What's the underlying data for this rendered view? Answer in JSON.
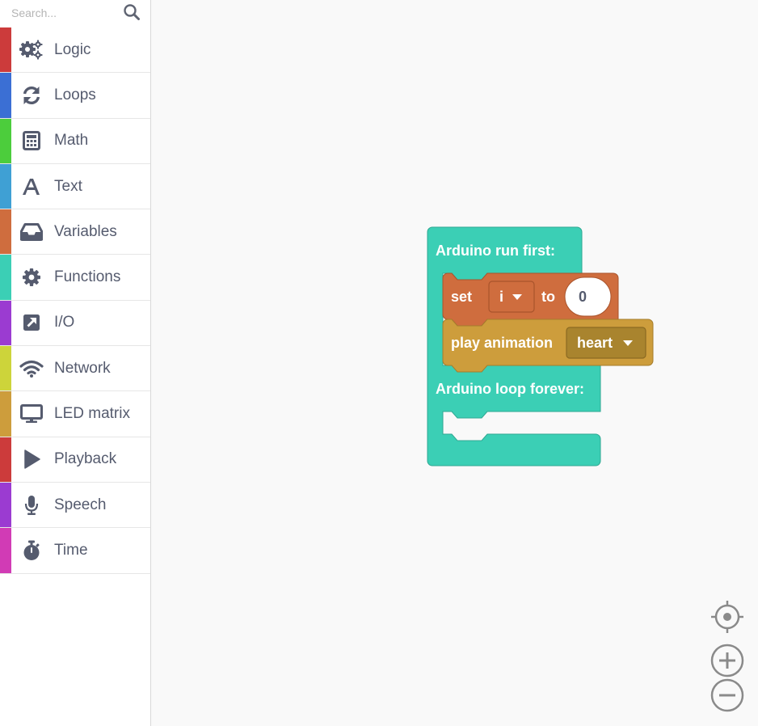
{
  "search": {
    "placeholder": "Search..."
  },
  "categories": [
    {
      "label": "Logic",
      "color": "#cc3b3b",
      "icon": "gears-icon"
    },
    {
      "label": "Loops",
      "color": "#3b6fd4",
      "icon": "refresh-icon"
    },
    {
      "label": "Math",
      "color": "#4ccd3c",
      "icon": "calculator-icon"
    },
    {
      "label": "Text",
      "color": "#3fa0d4",
      "icon": "font-icon"
    },
    {
      "label": "Variables",
      "color": "#cf6d3e",
      "icon": "inbox-icon"
    },
    {
      "label": "Functions",
      "color": "#3bcfb5",
      "icon": "gear-icon"
    },
    {
      "label": "I/O",
      "color": "#9b3bd1",
      "icon": "external-link-icon"
    },
    {
      "label": "Network",
      "color": "#cdd43a",
      "icon": "wifi-icon"
    },
    {
      "label": "LED matrix",
      "color": "#cd9d3c",
      "icon": "monitor-icon"
    },
    {
      "label": "Playback",
      "color": "#cc3b3b",
      "icon": "play-icon"
    },
    {
      "label": "Speech",
      "color": "#9b3bd1",
      "icon": "microphone-icon"
    },
    {
      "label": "Time",
      "color": "#d13bb5",
      "icon": "stopwatch-icon"
    }
  ],
  "blocks": {
    "main": {
      "run_first_label": "Arduino run first:",
      "loop_label": "Arduino loop forever:",
      "color": "#3bcfb5"
    },
    "set_block": {
      "set_label": "set",
      "variable": "i",
      "to_label": "to",
      "value": "0",
      "color": "#cf6d3e"
    },
    "animation_block": {
      "label": "play animation",
      "animation": "heart",
      "color": "#cd9d3c"
    }
  },
  "controls": {
    "icons": [
      "recenter-icon",
      "zoom-in-icon",
      "zoom-out-icon"
    ]
  }
}
